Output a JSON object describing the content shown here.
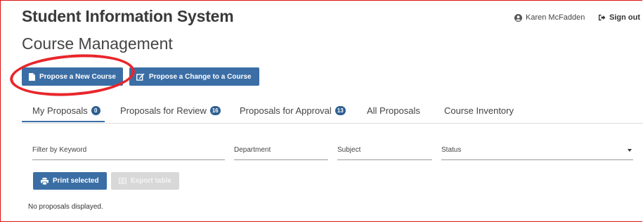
{
  "header": {
    "app_title": "Student Information System",
    "user_name": "Karen McFadden",
    "signout_label": "Sign out"
  },
  "page": {
    "title": "Course Management"
  },
  "actions": {
    "propose_new": "Propose a New Course",
    "propose_change": "Propose a Change to a Course"
  },
  "tabs": [
    {
      "label": "My Proposals",
      "badge": "0",
      "active": true
    },
    {
      "label": "Proposals for Review",
      "badge": "16"
    },
    {
      "label": "Proposals for Approval",
      "badge": "13"
    },
    {
      "label": "All Proposals"
    },
    {
      "label": "Course Inventory"
    }
  ],
  "filters": {
    "keyword": "Filter by Keyword",
    "department": "Department",
    "subject": "Subject",
    "status": "Status"
  },
  "table_actions": {
    "print": "Print selected",
    "export": "Export table"
  },
  "empty_message": "No proposals displayed.",
  "colors": {
    "primary": "#3b6ea5",
    "badge": "#2e5f91",
    "highlight": "#e8262b"
  }
}
